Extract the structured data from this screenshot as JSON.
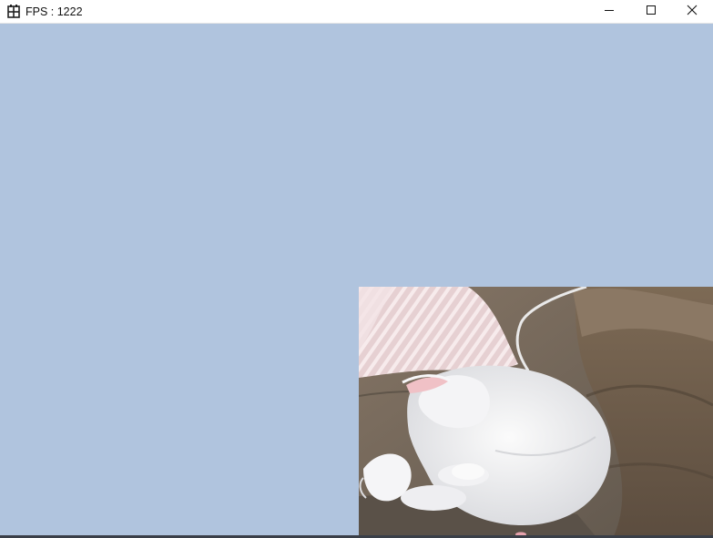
{
  "window": {
    "title": "FPS : 1222",
    "app_icon": "grid-app-icon",
    "controls": {
      "minimize_icon": "minimize-icon",
      "maximize_icon": "maximize-icon",
      "close_icon": "close-icon"
    }
  },
  "canvas": {
    "background_color": "#b0c4de",
    "sprite": {
      "subject": "white-cat-on-couch"
    }
  }
}
